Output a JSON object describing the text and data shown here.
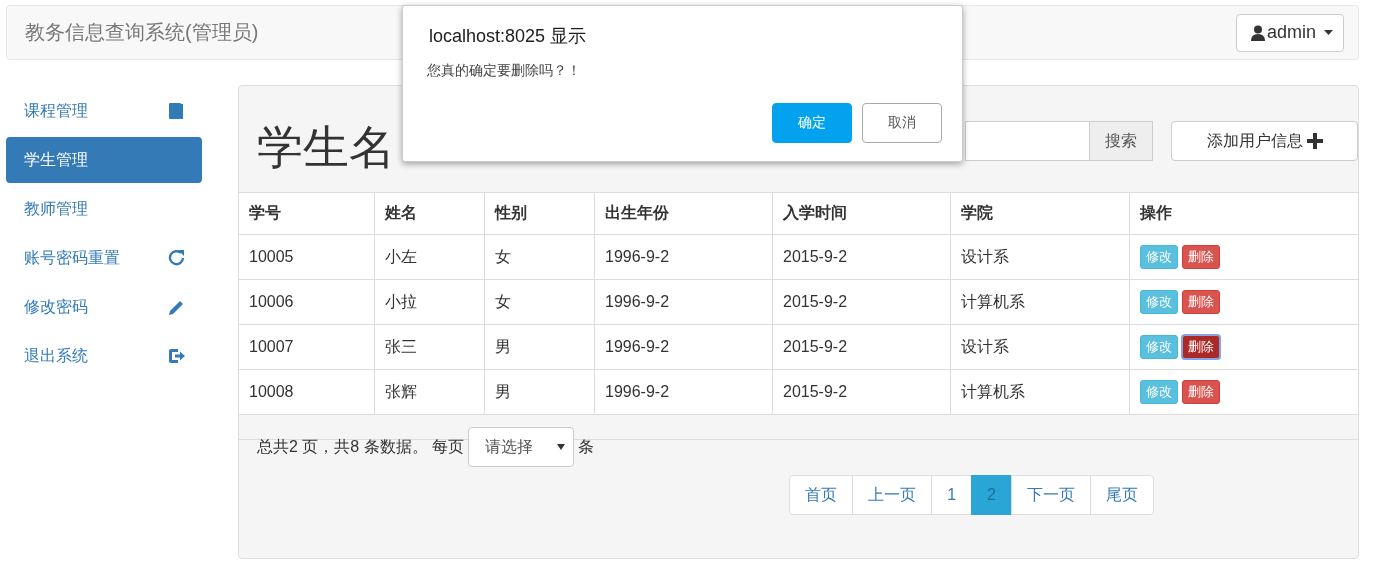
{
  "navbar": {
    "title": "教务信息查询系统(管理员)",
    "user_menu": "admin"
  },
  "sidebar": {
    "items": [
      {
        "label": "课程管理",
        "selected": false
      },
      {
        "label": "学生管理",
        "selected": true
      },
      {
        "label": "教师管理",
        "selected": false
      },
      {
        "label": "账号密码重置",
        "selected": false
      },
      {
        "label": "修改密码",
        "selected": false
      },
      {
        "label": "退出系统",
        "selected": false
      }
    ]
  },
  "panel": {
    "heading": "学生名",
    "search_button": "搜索",
    "add_button": "添加用户信息",
    "table": {
      "columns": [
        "学号",
        "姓名",
        "性别",
        "出生年份",
        "入学时间",
        "学院",
        "操作"
      ],
      "rows": [
        {
          "cells": [
            "10005",
            "小左",
            "女",
            "1996-9-2",
            "2015-9-2",
            "设计系"
          ],
          "edit": "修改",
          "delete": "删除",
          "delete_focused": false
        },
        {
          "cells": [
            "10006",
            "小拉",
            "女",
            "1996-9-2",
            "2015-9-2",
            "计算机系"
          ],
          "edit": "修改",
          "delete": "删除",
          "delete_focused": false
        },
        {
          "cells": [
            "10007",
            "张三",
            "男",
            "1996-9-2",
            "2015-9-2",
            "设计系"
          ],
          "edit": "修改",
          "delete": "删除",
          "delete_focused": true
        },
        {
          "cells": [
            "10008",
            "张辉",
            "男",
            "1996-9-2",
            "2015-9-2",
            "计算机系"
          ],
          "edit": "修改",
          "delete": "删除",
          "delete_focused": false
        }
      ]
    },
    "summary": "总共2 页，共8 条数据。 每页",
    "page_size_select": "请选择",
    "page_size_unit": "条",
    "pagination": [
      {
        "label": "首页",
        "selected": false
      },
      {
        "label": "上一页",
        "selected": false
      },
      {
        "label": "1",
        "selected": false
      },
      {
        "label": "2",
        "selected": true
      },
      {
        "label": "下一页",
        "selected": false
      },
      {
        "label": "尾页",
        "selected": false
      }
    ]
  },
  "dialog": {
    "title": "localhost:8025 显示",
    "message": "您真的确定要删除吗？！",
    "buttons": [
      {
        "label": "确定",
        "kind": "primary"
      },
      {
        "label": "取消",
        "kind": "default"
      }
    ]
  }
}
